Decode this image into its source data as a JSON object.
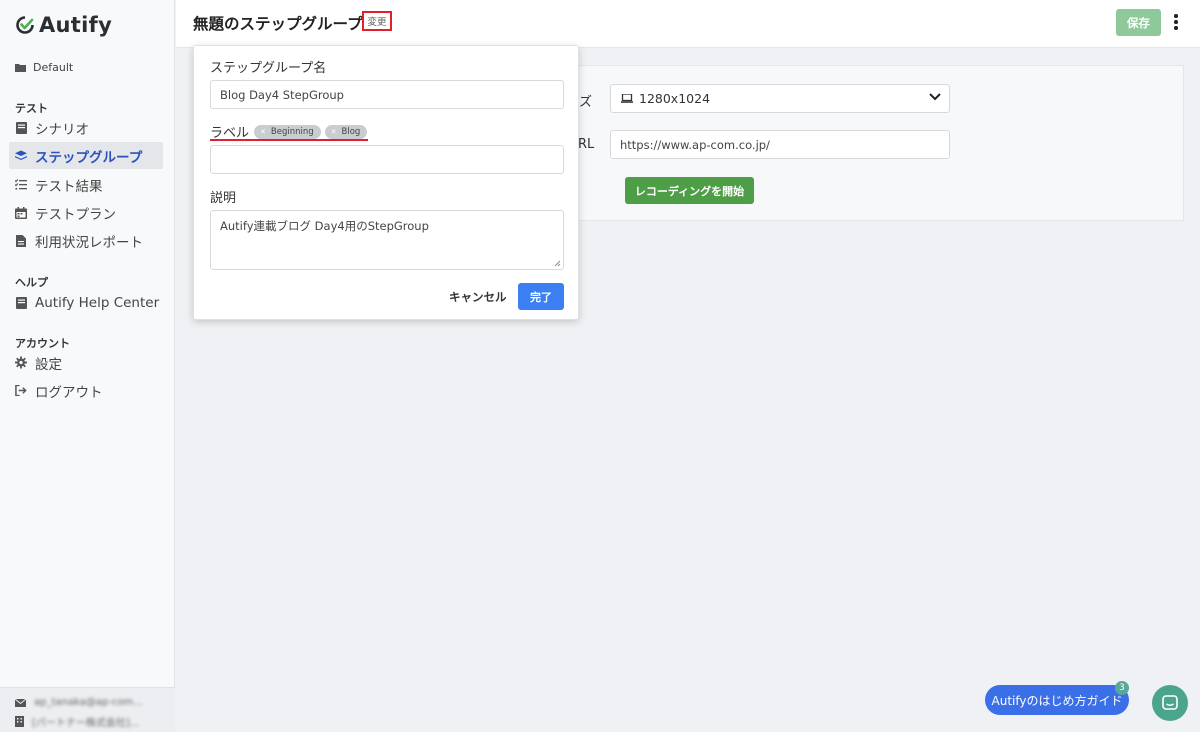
{
  "app": {
    "logo_text": "Autify"
  },
  "sidebar": {
    "workspace": "Default",
    "sections": {
      "test": "テスト",
      "help": "ヘルプ",
      "account": "アカウント"
    },
    "items": [
      {
        "label": "シナリオ",
        "icon": "book-icon"
      },
      {
        "label": "ステップグループ",
        "icon": "layers-icon",
        "active": true
      },
      {
        "label": "テスト結果",
        "icon": "checklist-icon"
      },
      {
        "label": "テストプラン",
        "icon": "calendar-icon"
      },
      {
        "label": "利用状況レポート",
        "icon": "document-icon"
      },
      {
        "label": "Autify Help Center",
        "icon": "book-icon"
      },
      {
        "label": "設定",
        "icon": "gear-icon"
      },
      {
        "label": "ログアウト",
        "icon": "logout-icon"
      }
    ],
    "footer": {
      "email": "ap_tanaka@ap-com...",
      "org": "[パートナー株式会社]..."
    }
  },
  "header": {
    "title": "無題のステップグループ",
    "edit_label": "変更",
    "save_label": "保存"
  },
  "main": {
    "size_label_fragment": "ズ",
    "url_label_fragment": "RL",
    "device_size": "1280x1024",
    "url_value": "https://www.ap-com.co.jp/",
    "record_button": "レコーディングを開始"
  },
  "popover": {
    "name_label": "ステップグループ名",
    "name_value": "Blog Day4 StepGroup",
    "labels_label": "ラベル",
    "tags": [
      "Beginning",
      "Blog"
    ],
    "description_label": "説明",
    "description_value": "Autify連載ブログ Day4用のStepGroup",
    "cancel_label": "キャンセル",
    "done_label": "完了"
  },
  "widgets": {
    "guide_label": "Autifyのはじめ方ガイド",
    "guide_badge": "3"
  },
  "colors": {
    "active_nav": "#2a52be",
    "save_button": "#8fc89a",
    "record_button": "#4e9d47",
    "done_button": "#3b7ff2",
    "highlight": "#e0202a"
  }
}
